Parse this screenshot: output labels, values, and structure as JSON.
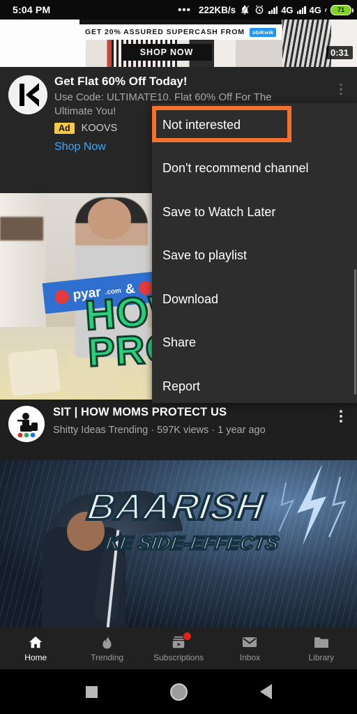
{
  "status_bar": {
    "time": "5:04 PM",
    "dots": "•••",
    "network_speed": "222KB/s",
    "icons": [
      "bell-off-icon",
      "alarm-icon",
      "signal-icon",
      "signal-icon"
    ],
    "network_1": "4G",
    "network_2": "4G",
    "roaming": "r",
    "battery_level": "71"
  },
  "ad_banner": {
    "headline": "GET 20% ASSURED SUPERCASH FROM",
    "brand_chip": "obiKwik",
    "cta": "SHOP NOW",
    "duration": "0:31"
  },
  "ad_card": {
    "logo": "koovs-logo",
    "title": "Get Flat 60% Off Today!",
    "subtitle": "Use Code: ULTIMATE10. Flat 60% Off For The Ultimate You!",
    "badge": "Ad",
    "brand": "KOOVS",
    "cta": "Shop Now",
    "kebab": "overflow-menu-icon"
  },
  "menu": {
    "items": [
      {
        "label": "Not interested",
        "highlighted": true
      },
      {
        "label": "Don't recommend channel",
        "highlighted": false
      },
      {
        "label": "Save to Watch Later",
        "highlighted": false
      },
      {
        "label": "Save to playlist",
        "highlighted": false
      },
      {
        "label": "Download",
        "highlighted": false
      },
      {
        "label": "Share",
        "highlighted": false
      },
      {
        "label": "Report",
        "highlighted": false
      }
    ],
    "highlight_color": "#f2722b",
    "background_color": "#2d2d2d"
  },
  "video_1": {
    "thumbnail_band_brand": "pyar",
    "thumbnail_band_brand_suffix": ".com",
    "thumbnail_band_amp": "&",
    "thumbnail_line_1": "HOW",
    "thumbnail_line_2": "PRO",
    "title": "SIT | HOW MOMS PROTECT US",
    "channel": "Shitty Ideas Trending",
    "views": "597K views",
    "age": "1 year ago",
    "meta": "Shitty Ideas Trending · 597K views · 1 year ago",
    "kebab": "overflow-menu-icon"
  },
  "video_2": {
    "title_main": "BAARISH",
    "title_sub": "KE SIDE-EFFECTS"
  },
  "bottom_nav": {
    "items": [
      {
        "label": "Home",
        "icon": "home-icon",
        "active": true,
        "badge": false
      },
      {
        "label": "Trending",
        "icon": "flame-icon",
        "active": false,
        "badge": false
      },
      {
        "label": "Subscriptions",
        "icon": "subscriptions-icon",
        "active": false,
        "badge": true
      },
      {
        "label": "Inbox",
        "icon": "envelope-icon",
        "active": false,
        "badge": false
      },
      {
        "label": "Library",
        "icon": "folder-icon",
        "active": false,
        "badge": false
      }
    ]
  },
  "android_nav": {
    "recents": "square-recents-icon",
    "home": "circle-home-icon",
    "back": "triangle-back-icon"
  }
}
